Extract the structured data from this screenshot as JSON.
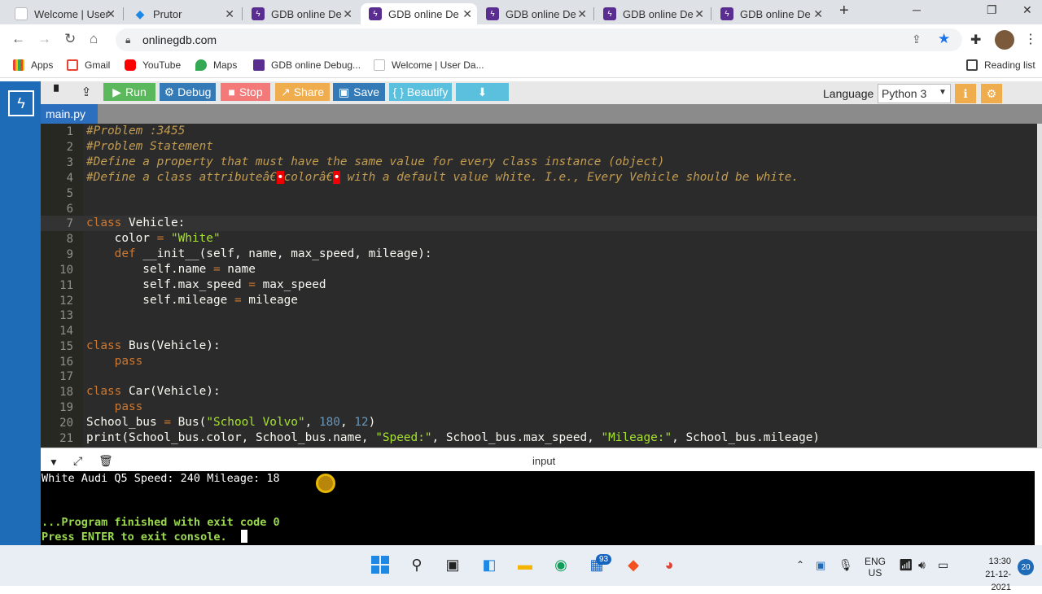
{
  "browser": {
    "tabs": [
      {
        "title": "Welcome | User",
        "icon": "doc-icon"
      },
      {
        "title": "Prutor",
        "icon": "prutor-icon"
      },
      {
        "title": "GDB online De",
        "icon": "gdb-icon"
      },
      {
        "title": "GDB online De",
        "icon": "gdb-icon",
        "active": true
      },
      {
        "title": "GDB online De",
        "icon": "gdb-icon"
      },
      {
        "title": "GDB online De",
        "icon": "gdb-icon"
      },
      {
        "title": "GDB online De",
        "icon": "gdb-icon"
      }
    ],
    "new_tab": "+",
    "url": "onlinegdb.com",
    "bookmarks": [
      "Apps",
      "Gmail",
      "YouTube",
      "Maps",
      "GDB online Debug...",
      "Welcome | User Da..."
    ],
    "reading_list": "Reading list"
  },
  "ide": {
    "buttons": {
      "run": "Run",
      "debug": "Debug",
      "stop": "Stop",
      "share": "Share",
      "save": "Save",
      "beautify": "{ } Beautify"
    },
    "language_label": "Language",
    "language_value": "Python 3",
    "file_tab": "main.py",
    "lines": [
      "#Problem :3455",
      "#Problem Statement",
      "#Define a property that must have the same value for every class instance (object)",
      "#Define a class attributeâ€•colorâ€• with a default value white. I.e., Every Vehicle should be white.",
      "",
      "",
      "class Vehicle:",
      "    color = \"White\"",
      "    def __init__(self, name, max_speed, mileage):",
      "        self.name = name",
      "        self.max_speed = max_speed",
      "        self.mileage = mileage",
      "",
      "",
      "class Bus(Vehicle):",
      "    pass",
      "",
      "class Car(Vehicle):",
      "    pass",
      "School_bus = Bus(\"School Volvo\", 180, 12)",
      "print(School_bus.color, School_bus.name, \"Speed:\", School_bus.max_speed, \"Mileage:\", School_bus.mileage)"
    ],
    "console_label": "input",
    "console": {
      "line1": "White Audi Q5 Speed: 240 Mileage: 18",
      "line2": "...Program finished with exit code 0",
      "line3": "Press ENTER to exit console."
    }
  },
  "taskbar": {
    "badge": "93",
    "lang_line1": "ENG",
    "lang_line2": "US",
    "time": "13:30",
    "date": "21-12-2021",
    "notifications": "20"
  }
}
